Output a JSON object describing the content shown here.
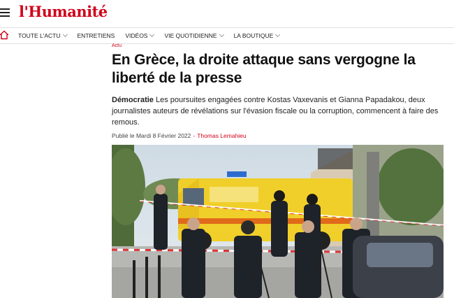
{
  "header": {
    "logo": "l'Humanité"
  },
  "nav": {
    "items": [
      {
        "label": "TOUTE L'ACTU",
        "has_dropdown": true
      },
      {
        "label": "ENTRETIENS",
        "has_dropdown": false
      },
      {
        "label": "VIDÉOS",
        "has_dropdown": true
      },
      {
        "label": "VIE QUOTIDIENNE",
        "has_dropdown": true
      },
      {
        "label": "LA BOUTIQUE",
        "has_dropdown": true
      }
    ]
  },
  "article": {
    "kicker": "Actu",
    "title": "En Grèce, la droite attaque sans vergogne la liberté de la presse",
    "lead_topic": "Démocratie",
    "lead_text": " Les poursuites engagées contre Kostas Vaxevanis et Gianna Papadakou, deux journalistes auteurs de révélations sur l'évasion fiscale ou la corruption, commencent à faire des remous.",
    "published": "Publié le Mardi 8 Février 2022",
    "separator": "-",
    "author": "Thomas Lemahieu"
  },
  "colors": {
    "brand": "#d0021b"
  }
}
